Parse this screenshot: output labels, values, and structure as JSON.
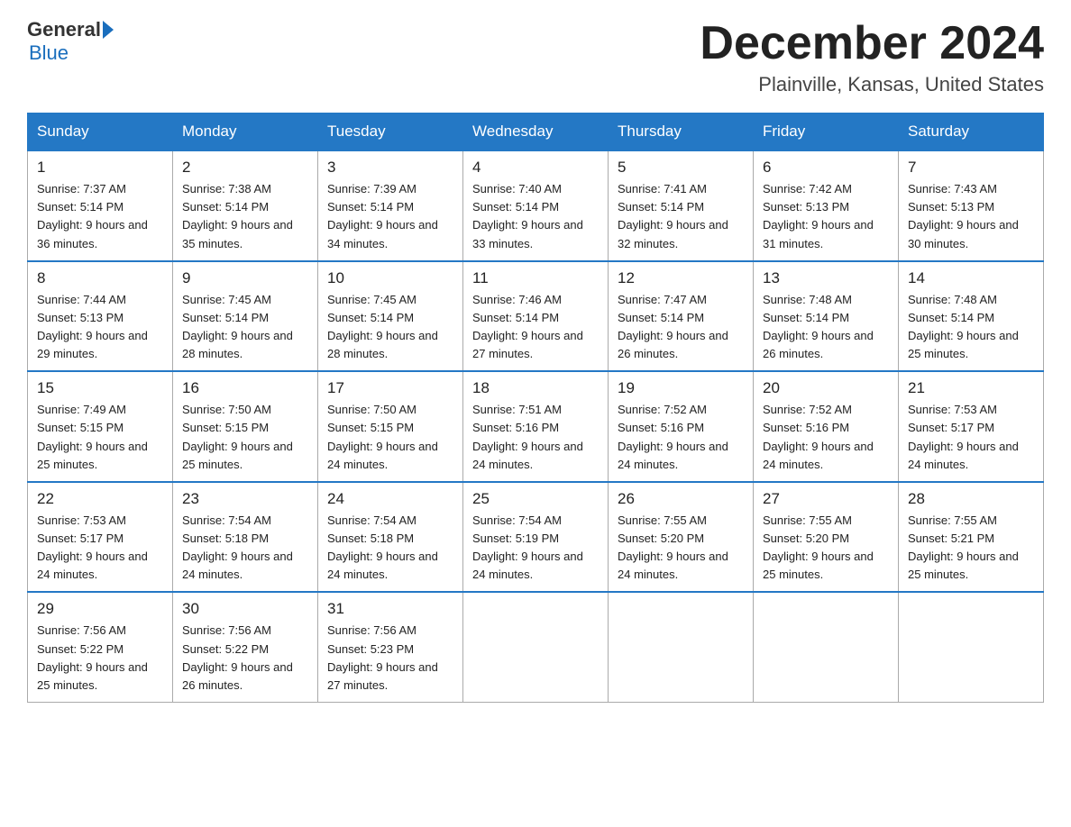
{
  "header": {
    "logo_general": "General",
    "logo_blue": "Blue",
    "month": "December 2024",
    "location": "Plainville, Kansas, United States"
  },
  "weekdays": [
    "Sunday",
    "Monday",
    "Tuesday",
    "Wednesday",
    "Thursday",
    "Friday",
    "Saturday"
  ],
  "weeks": [
    [
      {
        "day": "1",
        "sunrise": "Sunrise: 7:37 AM",
        "sunset": "Sunset: 5:14 PM",
        "daylight": "Daylight: 9 hours and 36 minutes."
      },
      {
        "day": "2",
        "sunrise": "Sunrise: 7:38 AM",
        "sunset": "Sunset: 5:14 PM",
        "daylight": "Daylight: 9 hours and 35 minutes."
      },
      {
        "day": "3",
        "sunrise": "Sunrise: 7:39 AM",
        "sunset": "Sunset: 5:14 PM",
        "daylight": "Daylight: 9 hours and 34 minutes."
      },
      {
        "day": "4",
        "sunrise": "Sunrise: 7:40 AM",
        "sunset": "Sunset: 5:14 PM",
        "daylight": "Daylight: 9 hours and 33 minutes."
      },
      {
        "day": "5",
        "sunrise": "Sunrise: 7:41 AM",
        "sunset": "Sunset: 5:14 PM",
        "daylight": "Daylight: 9 hours and 32 minutes."
      },
      {
        "day": "6",
        "sunrise": "Sunrise: 7:42 AM",
        "sunset": "Sunset: 5:13 PM",
        "daylight": "Daylight: 9 hours and 31 minutes."
      },
      {
        "day": "7",
        "sunrise": "Sunrise: 7:43 AM",
        "sunset": "Sunset: 5:13 PM",
        "daylight": "Daylight: 9 hours and 30 minutes."
      }
    ],
    [
      {
        "day": "8",
        "sunrise": "Sunrise: 7:44 AM",
        "sunset": "Sunset: 5:13 PM",
        "daylight": "Daylight: 9 hours and 29 minutes."
      },
      {
        "day": "9",
        "sunrise": "Sunrise: 7:45 AM",
        "sunset": "Sunset: 5:14 PM",
        "daylight": "Daylight: 9 hours and 28 minutes."
      },
      {
        "day": "10",
        "sunrise": "Sunrise: 7:45 AM",
        "sunset": "Sunset: 5:14 PM",
        "daylight": "Daylight: 9 hours and 28 minutes."
      },
      {
        "day": "11",
        "sunrise": "Sunrise: 7:46 AM",
        "sunset": "Sunset: 5:14 PM",
        "daylight": "Daylight: 9 hours and 27 minutes."
      },
      {
        "day": "12",
        "sunrise": "Sunrise: 7:47 AM",
        "sunset": "Sunset: 5:14 PM",
        "daylight": "Daylight: 9 hours and 26 minutes."
      },
      {
        "day": "13",
        "sunrise": "Sunrise: 7:48 AM",
        "sunset": "Sunset: 5:14 PM",
        "daylight": "Daylight: 9 hours and 26 minutes."
      },
      {
        "day": "14",
        "sunrise": "Sunrise: 7:48 AM",
        "sunset": "Sunset: 5:14 PM",
        "daylight": "Daylight: 9 hours and 25 minutes."
      }
    ],
    [
      {
        "day": "15",
        "sunrise": "Sunrise: 7:49 AM",
        "sunset": "Sunset: 5:15 PM",
        "daylight": "Daylight: 9 hours and 25 minutes."
      },
      {
        "day": "16",
        "sunrise": "Sunrise: 7:50 AM",
        "sunset": "Sunset: 5:15 PM",
        "daylight": "Daylight: 9 hours and 25 minutes."
      },
      {
        "day": "17",
        "sunrise": "Sunrise: 7:50 AM",
        "sunset": "Sunset: 5:15 PM",
        "daylight": "Daylight: 9 hours and 24 minutes."
      },
      {
        "day": "18",
        "sunrise": "Sunrise: 7:51 AM",
        "sunset": "Sunset: 5:16 PM",
        "daylight": "Daylight: 9 hours and 24 minutes."
      },
      {
        "day": "19",
        "sunrise": "Sunrise: 7:52 AM",
        "sunset": "Sunset: 5:16 PM",
        "daylight": "Daylight: 9 hours and 24 minutes."
      },
      {
        "day": "20",
        "sunrise": "Sunrise: 7:52 AM",
        "sunset": "Sunset: 5:16 PM",
        "daylight": "Daylight: 9 hours and 24 minutes."
      },
      {
        "day": "21",
        "sunrise": "Sunrise: 7:53 AM",
        "sunset": "Sunset: 5:17 PM",
        "daylight": "Daylight: 9 hours and 24 minutes."
      }
    ],
    [
      {
        "day": "22",
        "sunrise": "Sunrise: 7:53 AM",
        "sunset": "Sunset: 5:17 PM",
        "daylight": "Daylight: 9 hours and 24 minutes."
      },
      {
        "day": "23",
        "sunrise": "Sunrise: 7:54 AM",
        "sunset": "Sunset: 5:18 PM",
        "daylight": "Daylight: 9 hours and 24 minutes."
      },
      {
        "day": "24",
        "sunrise": "Sunrise: 7:54 AM",
        "sunset": "Sunset: 5:18 PM",
        "daylight": "Daylight: 9 hours and 24 minutes."
      },
      {
        "day": "25",
        "sunrise": "Sunrise: 7:54 AM",
        "sunset": "Sunset: 5:19 PM",
        "daylight": "Daylight: 9 hours and 24 minutes."
      },
      {
        "day": "26",
        "sunrise": "Sunrise: 7:55 AM",
        "sunset": "Sunset: 5:20 PM",
        "daylight": "Daylight: 9 hours and 24 minutes."
      },
      {
        "day": "27",
        "sunrise": "Sunrise: 7:55 AM",
        "sunset": "Sunset: 5:20 PM",
        "daylight": "Daylight: 9 hours and 25 minutes."
      },
      {
        "day": "28",
        "sunrise": "Sunrise: 7:55 AM",
        "sunset": "Sunset: 5:21 PM",
        "daylight": "Daylight: 9 hours and 25 minutes."
      }
    ],
    [
      {
        "day": "29",
        "sunrise": "Sunrise: 7:56 AM",
        "sunset": "Sunset: 5:22 PM",
        "daylight": "Daylight: 9 hours and 25 minutes."
      },
      {
        "day": "30",
        "sunrise": "Sunrise: 7:56 AM",
        "sunset": "Sunset: 5:22 PM",
        "daylight": "Daylight: 9 hours and 26 minutes."
      },
      {
        "day": "31",
        "sunrise": "Sunrise: 7:56 AM",
        "sunset": "Sunset: 5:23 PM",
        "daylight": "Daylight: 9 hours and 27 minutes."
      },
      null,
      null,
      null,
      null
    ]
  ]
}
